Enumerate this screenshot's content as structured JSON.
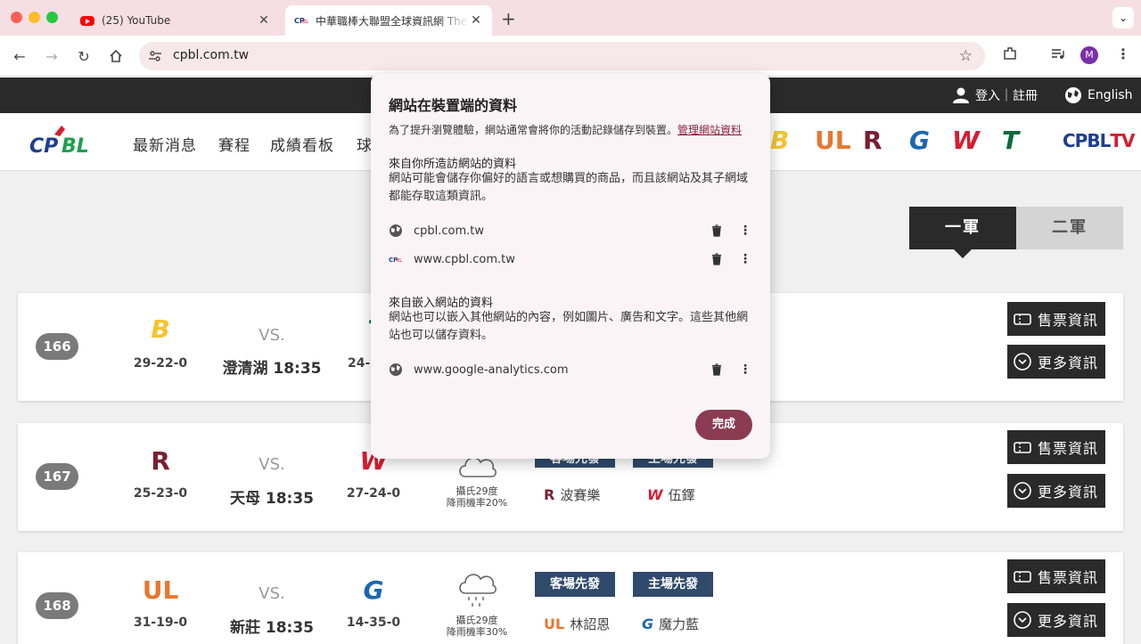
{
  "browser": {
    "tabs": [
      {
        "title": "(25) YouTube"
      },
      {
        "title": "中華職棒大聯盟全球資訊網 The"
      }
    ],
    "url": "cpbl.com.tw",
    "profile_initial": "M"
  },
  "site": {
    "topbar": {
      "login": "登入｜註冊",
      "lang": "English"
    },
    "logo_text": "CPBL",
    "nav": [
      "最新消息",
      "賽程",
      "成績看板",
      "球"
    ],
    "tv": {
      "a": "CPBL",
      "b": "TV"
    },
    "levels": [
      "一軍",
      "二軍"
    ],
    "games": [
      {
        "no": "166",
        "away_record": "29-22-0",
        "vs": "VS.",
        "venue": "澄清湖 18:35",
        "home_record": "24-"
      },
      {
        "no": "167",
        "away_record": "25-23-0",
        "vs": "VS.",
        "venue": "天母 18:35",
        "home_record": "27-24-0",
        "weather": [
          "攝氏29度",
          "降雨機率20%"
        ],
        "away_tag": "客場先發",
        "home_tag": "主場先發",
        "away_pitcher": "波賽樂",
        "home_pitcher": "伍鐸"
      },
      {
        "no": "168",
        "away_record": "31-19-0",
        "vs": "VS.",
        "venue": "新莊 18:35",
        "home_record": "14-35-0",
        "weather": [
          "攝氏29度",
          "降雨機率30%"
        ],
        "away_tag": "客場先發",
        "home_tag": "主場先發",
        "away_pitcher": "林詔恩",
        "home_pitcher": "魔力藍"
      }
    ],
    "buttons": {
      "ticket": "售票資訊",
      "more": "更多資訊"
    }
  },
  "popup": {
    "title": "網站在裝置端的資料",
    "intro": "為了提升瀏覽體驗，網站通常會將你的活動記錄儲存到裝置。",
    "manage_link": "管理網站資料",
    "visited_heading": "來自你所造訪網站的資料",
    "visited_desc": "網站可能會儲存你偏好的語言或想購買的商品，而且該網站及其子網域都能存取這類資訊。",
    "visited_sites": [
      "cpbl.com.tw",
      "www.cpbl.com.tw"
    ],
    "embedded_heading": "來自嵌入網站的資料",
    "embedded_desc": "網站也可以嵌入其他網站的內容，例如圖片、廣告和文字。這些其他網站也可以儲存資料。",
    "embedded_sites": [
      "www.google-analytics.com"
    ],
    "done": "完成"
  },
  "colors": {
    "accent": "#8b3b52",
    "tag": "#2f4a6b",
    "dark": "#2a2a2a"
  }
}
